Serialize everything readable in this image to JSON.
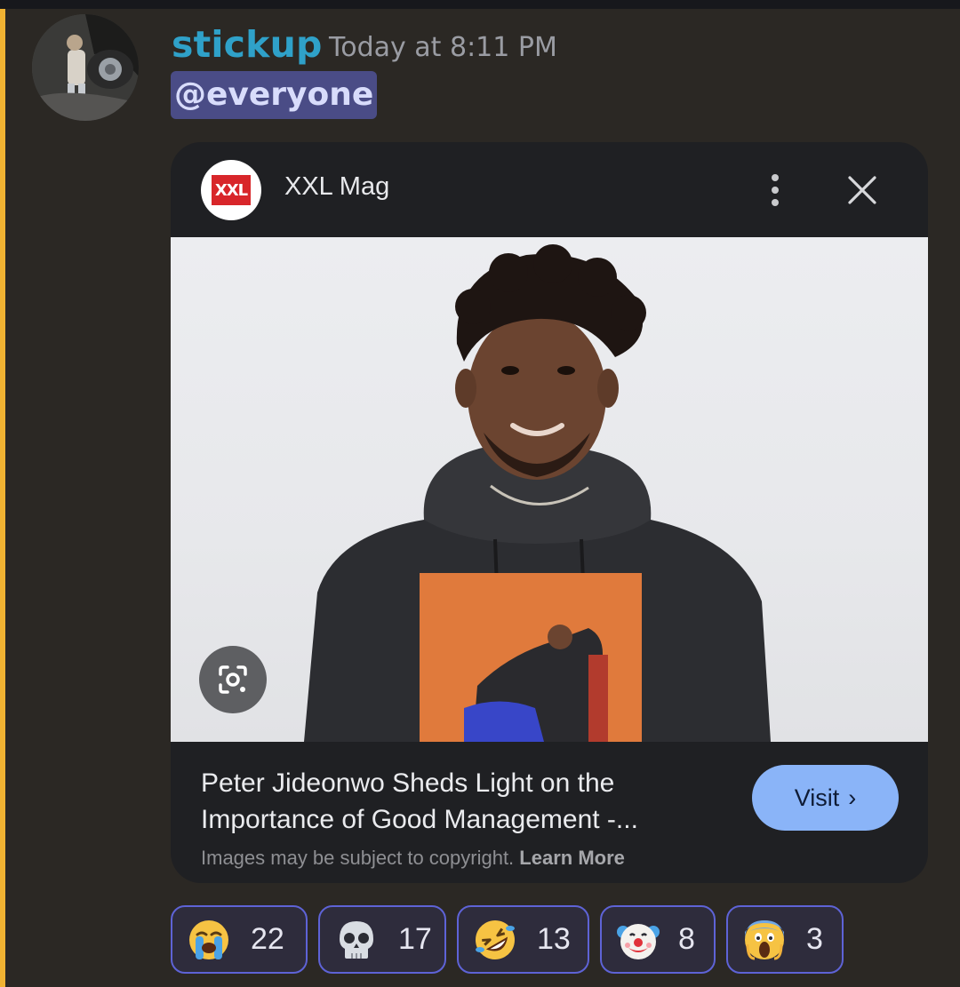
{
  "message": {
    "username": "stickup",
    "timestamp": "Today at 8:11 PM",
    "mention": "@everyone"
  },
  "card": {
    "source_logo_text": "XXL",
    "source_name": "XXL Mag",
    "menu_icon": "more-vert-icon",
    "close_icon": "close-icon",
    "lens_icon": "google-lens-icon",
    "article_title": "Peter Jideonwo Sheds Light on the Importance of Good Management -...",
    "copyright_text": "Images may be subject to copyright.",
    "learn_more": "Learn More",
    "visit_label": "Visit",
    "visit_chevron": "›"
  },
  "reactions": [
    {
      "emoji": "loudly-crying-face",
      "count": "22"
    },
    {
      "emoji": "skull",
      "count": "17"
    },
    {
      "emoji": "rolling-on-floor-laughing",
      "count": "13"
    },
    {
      "emoji": "clown-face",
      "count": "8"
    },
    {
      "emoji": "face-screaming-in-fear",
      "count": "3"
    }
  ],
  "colors": {
    "background": "#2b2824",
    "mention_bar": "#f0b232",
    "username": "#2fa1c9",
    "mention_bg": "#4a4c86",
    "visit_button": "#8ab4f8",
    "reaction_border": "#5e63d6"
  }
}
